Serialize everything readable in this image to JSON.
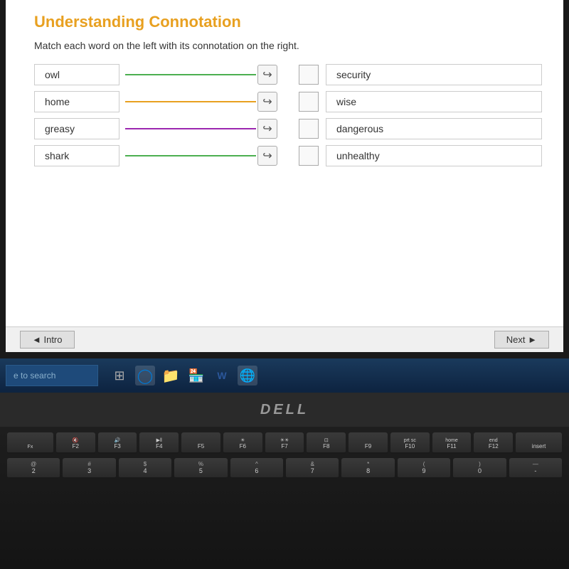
{
  "page": {
    "title": "Understanding Connotation",
    "instructions": "Match each word on the left with its connotation on the right."
  },
  "left_words": [
    {
      "id": "owl",
      "label": "owl",
      "line_color": "#4caf50"
    },
    {
      "id": "home",
      "label": "home",
      "line_color": "#e8a020"
    },
    {
      "id": "greasy",
      "label": "greasy",
      "line_color": "#9c27b0"
    },
    {
      "id": "shark",
      "label": "shark",
      "line_color": "#4caf50"
    }
  ],
  "right_words": [
    {
      "id": "security",
      "label": "security"
    },
    {
      "id": "wise",
      "label": "wise"
    },
    {
      "id": "dangerous",
      "label": "dangerous"
    },
    {
      "id": "unhealthy",
      "label": "unhealthy"
    }
  ],
  "nav": {
    "intro_label": "◄ Intro",
    "next_label": "Next ►"
  },
  "taskbar": {
    "search_placeholder": "e to search"
  },
  "dell": {
    "logo": "DELL"
  },
  "keyboard": {
    "fn_row": [
      "Fx",
      "F2",
      "F3",
      "F4",
      "F5",
      "F6",
      "F7",
      "F8",
      "F9",
      "F10",
      "F11",
      "F12",
      "ins"
    ],
    "num_row_top": [
      "@",
      "#",
      "$",
      "%",
      "^",
      "&",
      "*",
      "(",
      ")",
      "—"
    ],
    "num_row_bot": [
      "2",
      "3",
      "4",
      "5",
      "6",
      "7",
      "8",
      "9",
      "0",
      ""
    ]
  }
}
